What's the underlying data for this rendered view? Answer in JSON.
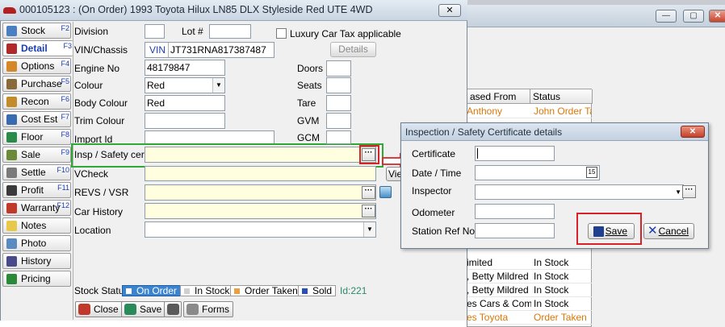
{
  "main_window": {
    "title": "000105123 : (On Order) 1993 Toyota Hilux LN85 DLX Styleside Red UTE 4WD",
    "close_label": "✕"
  },
  "sidebar": {
    "items": [
      {
        "label": "Stock",
        "fkey": "F2",
        "color": "#4a7fc1"
      },
      {
        "label": "Detail",
        "fkey": "F3",
        "color": "#b02a2a"
      },
      {
        "label": "Options",
        "fkey": "F4",
        "color": "#d4882a"
      },
      {
        "label": "Purchase",
        "fkey": "F5",
        "color": "#8a6a3a"
      },
      {
        "label": "Recon",
        "fkey": "F6",
        "color": "#c28b2c"
      },
      {
        "label": "Cost Est",
        "fkey": "F7",
        "color": "#3a6ab0"
      },
      {
        "label": "Floor",
        "fkey": "F8",
        "color": "#2a8a4a"
      },
      {
        "label": "Sale",
        "fkey": "F9",
        "color": "#6a8a3a"
      },
      {
        "label": "Settle",
        "fkey": "F10",
        "color": "#7a7a7a"
      },
      {
        "label": "Profit",
        "fkey": "F11",
        "color": "#3a3a3a"
      },
      {
        "label": "Warranty",
        "fkey": "F12",
        "color": "#c0392b"
      },
      {
        "label": "Notes",
        "fkey": "",
        "color": "#e8c84a"
      },
      {
        "label": "Photo",
        "fkey": "",
        "color": "#5a8ac0"
      },
      {
        "label": "History",
        "fkey": "",
        "color": "#4a4a8a"
      },
      {
        "label": "Pricing",
        "fkey": "",
        "color": "#2a8a3a"
      }
    ]
  },
  "form": {
    "division_label": "Division",
    "lot_label": "Lot #",
    "luxury_label": "Luxury Car Tax applicable",
    "vin_label": "VIN/Chassis",
    "vin_badge": "VIN",
    "vin_value": "JT731RNA817387487",
    "details_button": "Details",
    "engine_label": "Engine No",
    "engine_value": "48179847",
    "colour_label": "Colour",
    "colour_value": "Red",
    "body_colour_label": "Body Colour",
    "body_colour_value": "Red",
    "trim_label": "Trim Colour",
    "import_label": "Import Id",
    "insp_label": "Insp / Safety cert",
    "vcheck_label": "VCheck",
    "revs_label": "REVS / VSR",
    "car_history_label": "Car History",
    "location_label": "Location",
    "doors_label": "Doors",
    "seats_label": "Seats",
    "tare_label": "Tare",
    "gvm_label": "GVM",
    "gcm_label": "GCM",
    "view_button": "Vie",
    "dots": "···"
  },
  "stock_status": {
    "label": "Stock Status",
    "options": [
      {
        "label": "On Order",
        "color": "#3c84cf",
        "selected": true
      },
      {
        "label": "In Stock",
        "color": "#d0d0d0",
        "selected": false
      },
      {
        "label": "Order Taken",
        "color": "#e8a040",
        "selected": false
      },
      {
        "label": "Sold",
        "color": "#2a4fb0",
        "selected": false
      }
    ],
    "id_text": "Id:221"
  },
  "bottom_buttons": {
    "close": "Close",
    "save": "Save",
    "forms": "Forms"
  },
  "dialog": {
    "title": "Inspection / Safety Certificate details",
    "certificate_label": "Certificate",
    "date_label": "Date / Time",
    "inspector_label": "Inspector",
    "odometer_label": "Odometer",
    "station_label": "Station Ref No",
    "calendar_icon": "15",
    "save_button": "Save",
    "cancel_button": "Cancel",
    "close_label": "✕"
  },
  "background_list": {
    "headers": [
      "ased From",
      "Status"
    ],
    "rows": [
      {
        "from": "Anthony",
        "status": "John Order Taken",
        "highlight": true
      },
      {
        "from": "imited",
        "status": "In Stock",
        "highlight": false
      },
      {
        "from": ", Betty Mildred",
        "status": "In Stock",
        "highlight": false
      },
      {
        "from": ", Betty Mildred",
        "status": "In Stock",
        "highlight": false
      },
      {
        "from": "es Cars & Comme",
        "status": "In Stock",
        "highlight": false
      },
      {
        "from": "es Toyota",
        "status": "Order Taken",
        "highlight": true
      }
    ]
  }
}
